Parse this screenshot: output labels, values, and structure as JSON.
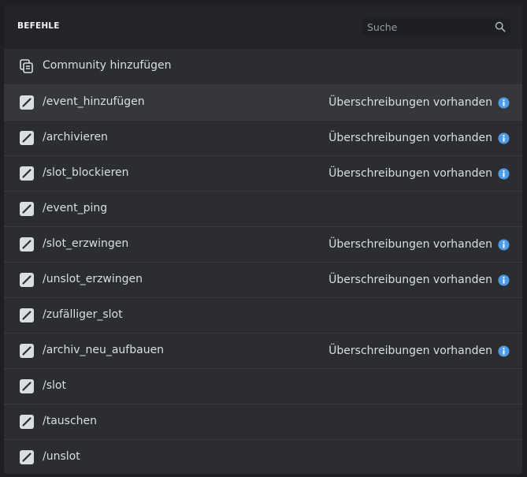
{
  "header": {
    "title": "BEFEHLE",
    "search_placeholder": "Suche",
    "search_value": ""
  },
  "community_row": {
    "label": "Community hinzufügen",
    "icon": "server-copy-icon"
  },
  "override_label": "Überschreibungen vorhanden",
  "commands": [
    {
      "label": "/event_hinzufügen",
      "override": "Überschreibungen vorhanden"
    },
    {
      "label": "/archivieren",
      "override": "Überschreibungen vorhanden"
    },
    {
      "label": "/slot_blockieren",
      "override": "Überschreibungen vorhanden"
    },
    {
      "label": "/event_ping",
      "override": ""
    },
    {
      "label": "/slot_erzwingen",
      "override": "Überschreibungen vorhanden"
    },
    {
      "label": "/unslot_erzwingen",
      "override": "Überschreibungen vorhanden"
    },
    {
      "label": "/zufälliger_slot",
      "override": ""
    },
    {
      "label": "/archiv_neu_aufbauen",
      "override": "Überschreibungen vorhanden"
    },
    {
      "label": "/slot",
      "override": ""
    },
    {
      "label": "/tauschen",
      "override": ""
    },
    {
      "label": "/unslot",
      "override": ""
    }
  ],
  "colors": {
    "background": "#1e1f22",
    "panel": "#2b2d31",
    "header": "#232428",
    "active_row": "#35373c",
    "text": "#dbdee1",
    "info_accent": "#5865f2"
  }
}
